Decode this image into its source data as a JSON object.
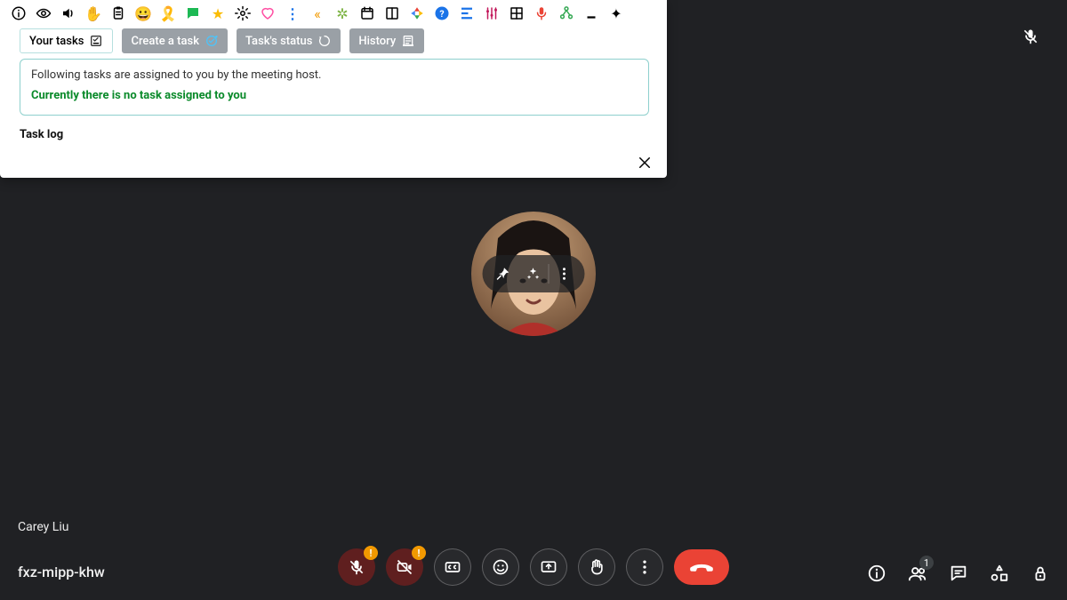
{
  "panel": {
    "tabs": {
      "your_tasks": "Your tasks",
      "create_task": "Create a task",
      "task_status": "Task's status",
      "history": "History"
    },
    "task_box": {
      "description": "Following tasks are assigned to you by the meeting host.",
      "empty": "Currently there is no task assigned to you"
    },
    "task_log": "Task log"
  },
  "participant": {
    "name": "Carey Liu"
  },
  "meeting": {
    "code": "fxz-mipp-khw",
    "people_count": "1"
  },
  "controls": {
    "mic_alert": "!",
    "cam_alert": "!"
  }
}
